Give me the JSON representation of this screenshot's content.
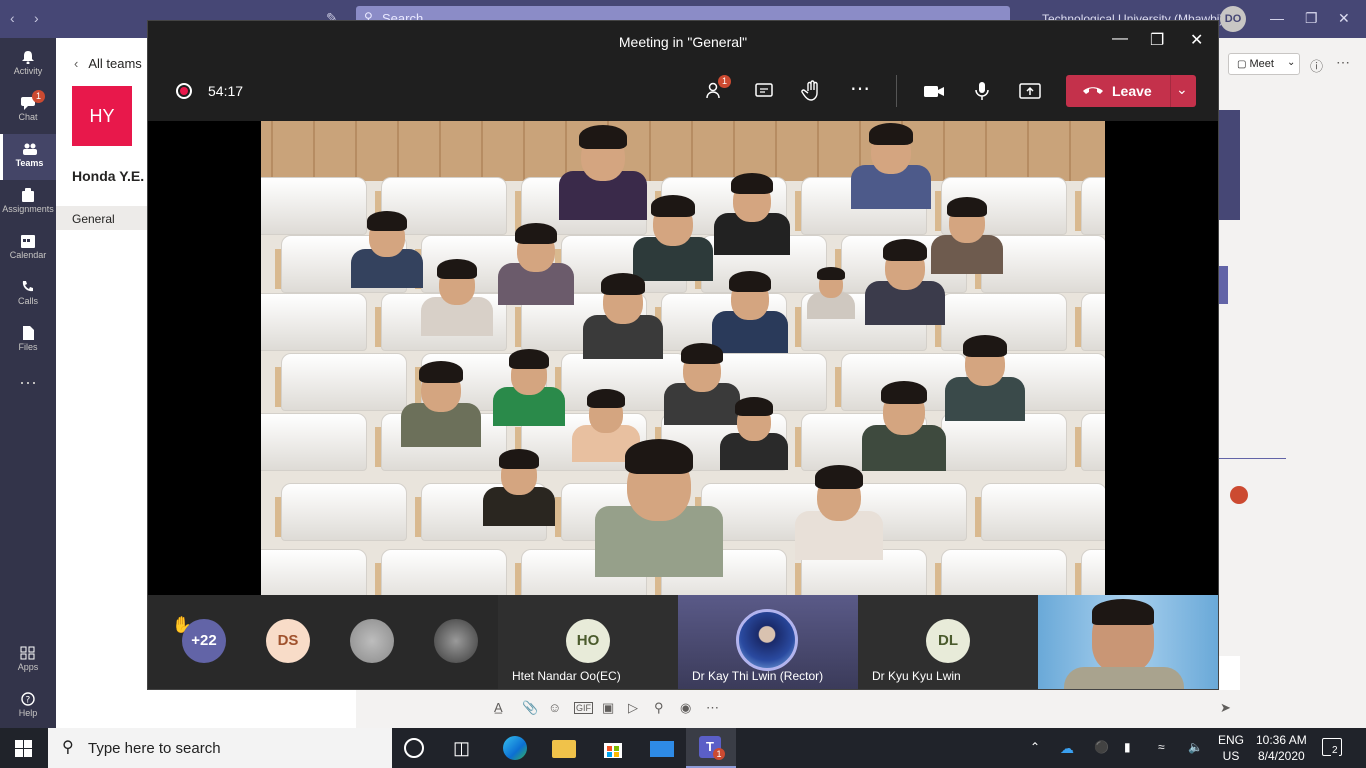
{
  "teams_bar": {
    "search_placeholder": "Search",
    "org_name": "Technological University (Mbawbi)",
    "avatar_initials": "DO"
  },
  "rail": {
    "items": [
      {
        "label": "Activity",
        "icon": "bell-icon"
      },
      {
        "label": "Chat",
        "icon": "chat-icon",
        "badge": "1"
      },
      {
        "label": "Teams",
        "icon": "teams-icon"
      },
      {
        "label": "Assignments",
        "icon": "assignments-icon"
      },
      {
        "label": "Calendar",
        "icon": "calendar-icon"
      },
      {
        "label": "Calls",
        "icon": "phone-icon"
      },
      {
        "label": "Files",
        "icon": "files-icon"
      },
      {
        "label": "",
        "icon": "more-icon"
      },
      {
        "label": "Apps",
        "icon": "apps-icon"
      },
      {
        "label": "Help",
        "icon": "help-icon"
      }
    ]
  },
  "panel": {
    "back_label": "All teams",
    "team_initials": "HY",
    "team_name": "Honda Y.E.",
    "channel": "General"
  },
  "header_right": {
    "meet_label": "Meet"
  },
  "meeting": {
    "title": "Meeting in \"General\"",
    "timer": "54:17",
    "participants_badge": "1",
    "leave_label": "Leave"
  },
  "strip": {
    "overflow": "+22",
    "tiles": [
      {
        "initials": "DS"
      },
      {
        "initials": "HO",
        "name": "Htet Nandar Oo(EC)"
      },
      {
        "name": "Dr Kay Thi Lwin (Rector)"
      },
      {
        "initials": "DL",
        "name": "Dr Kyu Kyu Lwin"
      }
    ]
  },
  "taskbar": {
    "search_placeholder": "Type here to search",
    "lang_top": "ENG",
    "lang_bottom": "US",
    "time": "10:36 AM",
    "date": "8/4/2020",
    "notif_count": "2",
    "teams_badge": "1"
  },
  "colors": {
    "teams_purple": "#464775",
    "rail": "#33344a",
    "leave_red": "#c4314b",
    "team_tile": "#e8184b"
  }
}
